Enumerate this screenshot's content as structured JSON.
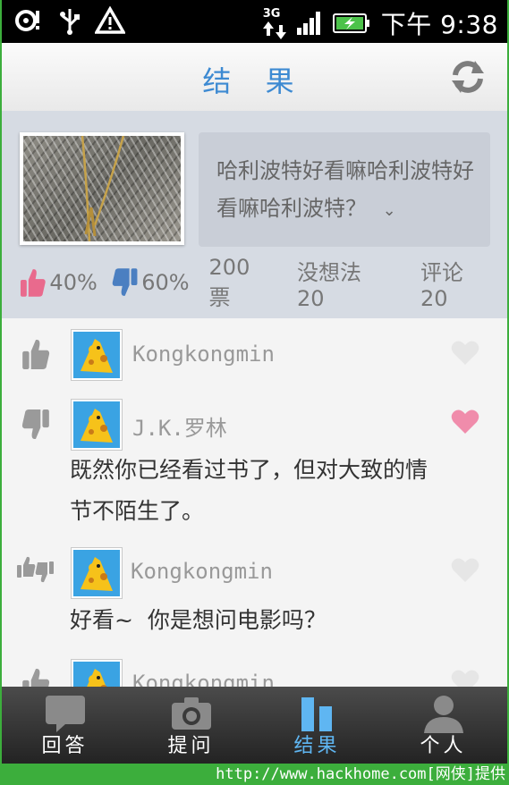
{
  "status_bar": {
    "network": "3G",
    "time": "下午 9:38"
  },
  "header": {
    "title": "结 果"
  },
  "question": {
    "text": "哈利波特好看嘛哈利波特好看嘛哈利波特？",
    "expand_glyph": "⌄",
    "stats": {
      "like_percent": "40%",
      "dislike_percent": "60%",
      "votes": "200票",
      "no_opinion": "没想法 20",
      "comments": "评论20"
    }
  },
  "answers": [
    {
      "vote": "up",
      "user": "Kongkongmin",
      "text": "",
      "liked": false
    },
    {
      "vote": "down",
      "user": "J.K.罗林",
      "text": "既然你已经看过书了，但对大致的情节不陌生了。",
      "liked": true
    },
    {
      "vote": "both",
      "user": "Kongkongmin",
      "text": "好看~  你是想问电影吗？",
      "liked": false
    },
    {
      "vote": "up",
      "user": "Kongkongmin",
      "text": "",
      "liked": false
    }
  ],
  "bottom_nav": {
    "tabs": [
      {
        "label": "回答",
        "icon": "speech-bubble-icon",
        "active": false
      },
      {
        "label": "提问",
        "icon": "camera-icon",
        "active": false
      },
      {
        "label": "结果",
        "icon": "bar-chart-icon",
        "active": true
      },
      {
        "label": "个人",
        "icon": "person-icon",
        "active": false
      }
    ]
  },
  "watermark": "http://www.hackhome.com[网侠]提供",
  "colors": {
    "accent": "#3d8ad2",
    "like": "#e96a8d",
    "dislike": "#4b7fc1",
    "active_tab": "#5fb6f2",
    "page_border": "#3cae3c"
  }
}
